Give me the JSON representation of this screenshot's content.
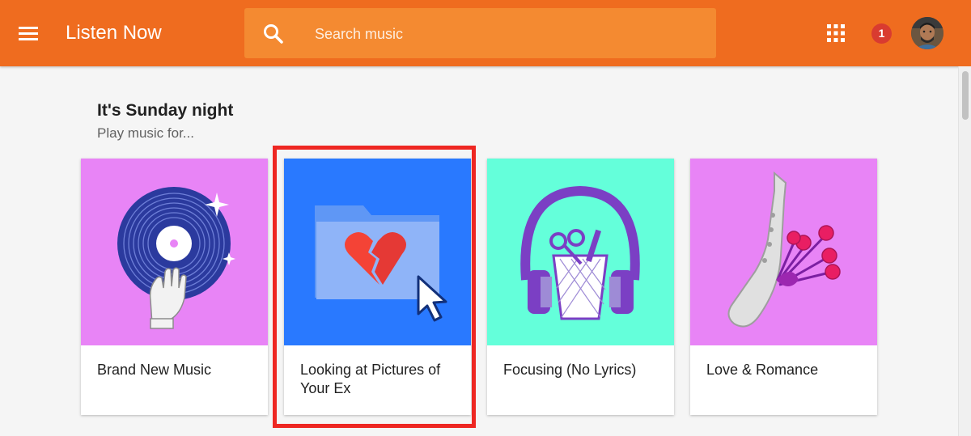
{
  "header": {
    "title": "Listen Now",
    "search_placeholder": "Search music",
    "notification_count": "1",
    "icons": [
      "menu-icon",
      "search-icon",
      "apps-grid-icon",
      "avatar"
    ],
    "bar_color": "#ef6c1f",
    "search_color": "#f48a31"
  },
  "section": {
    "title": "It's Sunday night",
    "subtitle": "Play music for..."
  },
  "cards": [
    {
      "label": "Brand New Music",
      "art": "vinyl-record-with-hand",
      "color": "#e884f6"
    },
    {
      "label": "Looking at Pictures of Your Ex",
      "art": "folder-with-broken-heart",
      "color": "#2979ff"
    },
    {
      "label": "Focusing (No Lyrics)",
      "art": "headphones-with-pencil-cup",
      "color": "#64ffda"
    },
    {
      "label": "Love & Romance",
      "art": "saxophone-with-roses",
      "color": "#e884f6"
    }
  ],
  "highlight": {
    "target": "cards.1",
    "color": "#ee2722"
  }
}
